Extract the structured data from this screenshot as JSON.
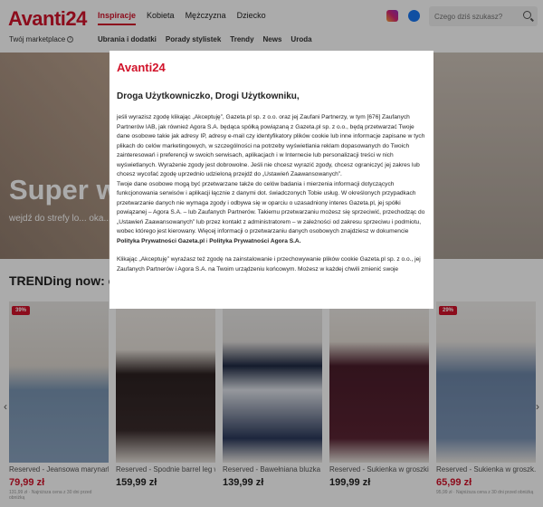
{
  "header": {
    "logo": "Avanti24",
    "tagline": "Twój marketplace",
    "nav_main": [
      "Inspiracje",
      "Kobieta",
      "Mężczyzna",
      "Dziecko"
    ],
    "nav_sub": [
      "Ubrania i dodatki",
      "Porady stylistek",
      "Trendy",
      "News",
      "Uroda"
    ],
    "search_placeholder": "Czego dziś szukasz?"
  },
  "hero": {
    "title": "Super w",
    "subtitle": "wejdź do strefy lo... oka..."
  },
  "section": {
    "title": "TRENDing now: czek"
  },
  "products": [
    {
      "badge": "39%",
      "name": "Reserved - Jeansowa marynark...",
      "price": "79,99 zł",
      "sale": true,
      "note": "131,99 zł · Najniższa cena z 30 dni przed obniżką"
    },
    {
      "badge": "",
      "name": "Reserved - Spodnie barrel leg w...",
      "price": "159,99 zł",
      "sale": false,
      "note": ""
    },
    {
      "badge": "",
      "name": "Reserved - Bawełniana bluzka w...",
      "price": "139,99 zł",
      "sale": false,
      "note": ""
    },
    {
      "badge": "",
      "name": "Reserved - Sukienka w groszki -...",
      "price": "199,99 zł",
      "sale": false,
      "note": ""
    },
    {
      "badge": "29%",
      "name": "Reserved - Sukienka w groszk...",
      "price": "65,99 zł",
      "sale": true,
      "note": "95,99 zł · Najniższa cena z 30 dni przed obniżką"
    }
  ],
  "modal": {
    "logo": "Avanti24",
    "title": "Droga Użytkowniczko, Drogi Użytkowniku,",
    "p1": "jeśli wyrazisz zgodę klikając „Akceptuję”, Gazeta.pl sp. z o.o. oraz jej Zaufani Partnerzy, w tym [676] Zaufanych Partnerów IAB, jak również Agora S.A. będąca spółką powiązaną z Gazeta.pl sp. z o.o., będą przetwarzać Twoje dane osobowe takie jak adresy IP, adresy e-mail czy identyfikatory plików cookie lub inne informacje zapisane w tych plikach do celów marketingowych, w szczególności na potrzeby wyświetlania reklam dopasowanych do Twoich zainteresowań i preferencji w swoich serwisach, aplikacjach i w Internecie lub personalizacji treści w nich wyświetlanych. Wyrażenie zgody jest dobrowolne. Jeśli nie chcesz wyrazić zgody, chcesz ograniczyć jej zakres lub chcesz wycofać zgodę uprzednio udzieloną przejdź do „Ustawień Zaawansowanych”.",
    "p2a": "Twoje dane osobowe mogą być przetwarzane także do celów badania i mierzenia informacji dotyczących funkcjonowania serwisów i aplikacji łącznie z danymi dot. świadczonych Tobie usług. W określonych przypadkach przetwarzanie danych nie wymaga zgody i odbywa się w oparciu o uzasadniony interes Gazeta.pl, jej spółki powiązanej – Agora S.A. – lub Zaufanych Partnerów. Takiemu przetwarzaniu możesz się sprzeciwić, przechodząc do „Ustawień Zaawansowanych” lub przez kontakt z administratorem – w zależności od zakresu sprzeciwu i podmiotu, wobec którego jest kierowany. Więcej informacji o przetwarzaniu danych osobowych znajdziesz w dokumencie ",
    "link1": "Polityka Prywatności Gazeta.pl",
    "sep": " i ",
    "link2": "Polityka Prywatności Agora S.A.",
    "p3": "Klikając „Akceptuję” wyrażasz też zgodę na zainstalowanie i przechowywanie plików cookie Gazeta.pl sp. z o.o., jej Zaufanych Partnerów i Agora S.A. na Twoim urządzeniu końcowym. Możesz w każdej chwili zmienić swoje"
  },
  "colors": {
    "brand": "#d1132a"
  }
}
